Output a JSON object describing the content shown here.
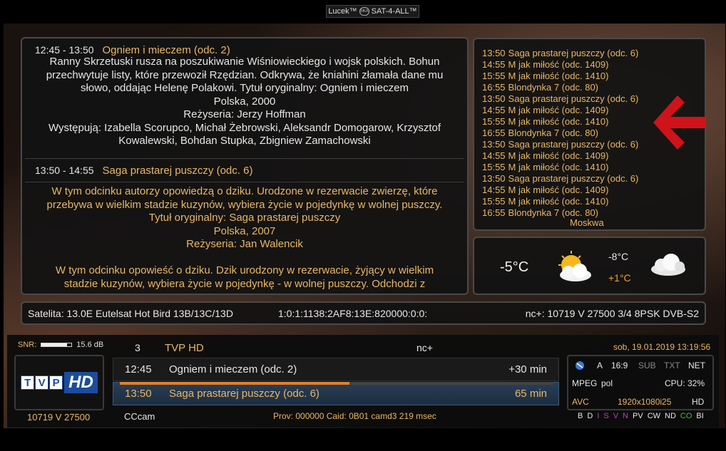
{
  "top_title": {
    "brand": "Lucek™",
    "badge": "SKA",
    "network": "SAT-4-ALL™"
  },
  "epg": {
    "first": {
      "time": "12:45 - 13:50",
      "title": "Ogniem i mieczem (odc. 2)",
      "lines": [
        "Ranny Skrzetuski rusza na poszukiwanie Wiśniowieckiego i wojsk polskich. Bohun",
        "przechwytuje listy, które przewoził Rzędzian. Odkrywa, że kniahini złamała dane mu",
        "słowo, oddając Helenę Polakowi. Tytuł oryginalny: Ogniem i mieczem",
        "Polska, 2000",
        "Reżyseria: Jerzy Hoffman",
        "Występują: Izabella Scorupco, Michał Żebrowski, Aleksandr Domogarow, Krzysztof",
        "Kowalewski, Bohdan Stupka, Zbigniew Zamachowski"
      ]
    },
    "second": {
      "time": "13:50 - 14:55",
      "title": "Saga prastarej puszczy (odc. 6)",
      "lines": [
        "W tym odcinku autorzy opowiedzą o dziku. Urodzone w rezerwacie zwierzę, które",
        "przebywa w wielkim stadzie kuzynów, wybiera życie w pojedynkę w wolnej puszczy.",
        "Tytuł oryginalny: Saga prastarej puszczy",
        "Polska, 2007",
        "Reżyseria: Jan Walencik",
        "",
        "W tym odcinku opowieść o dziku. Dzik urodzony w rezerwacie, żyjący w wielkim",
        "stadzie kuzynów, wybiera życie w pojedynkę - w wolnej puszczy. Odchodzi z"
      ]
    }
  },
  "schedule": [
    {
      "time": "13:50",
      "title": "Saga prastarej puszczy (odc. 6)"
    },
    {
      "time": "14:55",
      "title": "M jak miłość (odc. 1409)"
    },
    {
      "time": "15:55",
      "title": "M jak miłość (odc. 1410)"
    },
    {
      "time": "16:55",
      "title": "Blondynka 7 (odc. 80)"
    },
    {
      "time": "13:50",
      "title": "Saga prastarej puszczy (odc. 6)"
    },
    {
      "time": "14:55",
      "title": "M jak miłość (odc. 1409)"
    },
    {
      "time": "15:55",
      "title": "M jak miłość (odc. 1410)"
    },
    {
      "time": "16:55",
      "title": "Blondynka 7 (odc. 80)"
    },
    {
      "time": "13:50",
      "title": "Saga prastarej puszczy (odc. 6)"
    },
    {
      "time": "14:55",
      "title": "M jak miłość (odc. 1409)"
    },
    {
      "time": "15:55",
      "title": "M jak miłość (odc. 1410)"
    },
    {
      "time": "13:50",
      "title": "Saga prastarej puszczy (odc. 6)"
    },
    {
      "time": "14:55",
      "title": "M jak miłość (odc. 1409)"
    },
    {
      "time": "15:55",
      "title": "M jak miłość (odc. 1410)"
    },
    {
      "time": "16:55",
      "title": "Blondynka 7 (odc. 80)"
    }
  ],
  "schedule_tail": "Moskwa",
  "weather": {
    "current": "-5°C",
    "high": "-8°C",
    "low": "+1°C",
    "icon_today": "sun-cloud-icon",
    "icon_tomorrow": "cloud-icon"
  },
  "satellite": {
    "label": "Satelita:",
    "name": "13.0E Eutelsat Hot Bird 13B/13C/13D",
    "service_ref": "1:0:1:1138:2AF8:13E:820000:0:0:",
    "tp_label": "nc+:",
    "transponder": "10719 V 27500 3/4 8PSK DVB-S2"
  },
  "infobar": {
    "snr_label": "SNR:",
    "snr_value": "15.6 dB",
    "snr_fraction": 0.85,
    "channel_number": "3",
    "channel_name": "TVP HD",
    "provider": "nc+",
    "datetime": "sob, 19.01.2019 13:19:56",
    "logo_tvp": [
      "T",
      "V",
      "P"
    ],
    "logo_hd": "HD",
    "frequency": "10719 V 27500",
    "now": {
      "time": "12:45",
      "title": "Ogniem i mieczem (odc. 2)",
      "remaining": "+30 min",
      "progress": 0.53
    },
    "next": {
      "time": "13:50",
      "title": "Saga prastarej puszczy (odc. 6)",
      "duration": "65 min"
    },
    "cam": "CCcam",
    "prov_info": "Prov: 000000 Caid: 0B01 camd3 219 msec"
  },
  "tech": {
    "a": "A",
    "aspect": "16:9",
    "sub": "SUB",
    "txt": "TXT",
    "net": "NET",
    "codec": "MPEG",
    "lang": "pol",
    "cpu": "CPU: 32%",
    "video": "AVC",
    "resolution": "1920x1080i25",
    "hd": "HD",
    "flags": [
      "B",
      "D",
      "I",
      "S",
      "V",
      "N",
      "PV",
      "CW",
      "ND",
      "CO",
      "BI"
    ]
  }
}
